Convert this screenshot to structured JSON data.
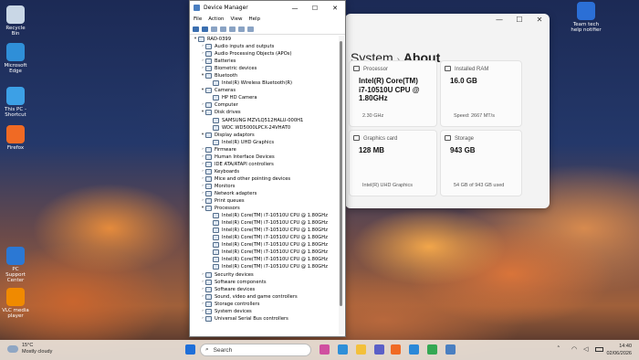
{
  "desktop": {
    "icons": [
      {
        "label": "Recycle Bin",
        "color": "#c9d7e6"
      },
      {
        "label": "Microsoft Edge",
        "color": "#2f8fd8"
      },
      {
        "label": "This PC - Shortcut",
        "color": "#3ca0e6"
      },
      {
        "label": "Firefox",
        "color": "#f06a24"
      },
      {
        "label": "PC Support Center",
        "color": "#2b78d4"
      },
      {
        "label": "VLC media player",
        "color": "#f08a00"
      }
    ],
    "right_icon": {
      "label": "Team tech help notifier",
      "color": "#2b6fd6"
    }
  },
  "device_manager": {
    "title": "Device Manager",
    "controls": [
      "—",
      "☐",
      "✕"
    ],
    "menu": [
      "File",
      "Action",
      "View",
      "Help"
    ],
    "tree": [
      {
        "label": "RAD-0399",
        "level": 0,
        "arrow": "▾"
      },
      {
        "label": "Audio inputs and outputs",
        "level": 1,
        "arrow": "›"
      },
      {
        "label": "Audio Processing Objects (APOs)",
        "level": 1,
        "arrow": "›"
      },
      {
        "label": "Batteries",
        "level": 1,
        "arrow": "›"
      },
      {
        "label": "Biometric devices",
        "level": 1,
        "arrow": "›"
      },
      {
        "label": "Bluetooth",
        "level": 1,
        "arrow": "▾"
      },
      {
        "label": "Intel(R) Wireless Bluetooth(R)",
        "level": 2,
        "arrow": ""
      },
      {
        "label": "Cameras",
        "level": 1,
        "arrow": "▾"
      },
      {
        "label": "HP HD Camera",
        "level": 2,
        "arrow": ""
      },
      {
        "label": "Computer",
        "level": 1,
        "arrow": "›"
      },
      {
        "label": "Disk drives",
        "level": 1,
        "arrow": "▾"
      },
      {
        "label": "SAMSUNG MZVLQ512HALU-000H1",
        "level": 2,
        "arrow": ""
      },
      {
        "label": "WDC WD5000LPCX-24VHAT0",
        "level": 2,
        "arrow": ""
      },
      {
        "label": "Display adaptors",
        "level": 1,
        "arrow": "▾"
      },
      {
        "label": "Intel(R) UHD Graphics",
        "level": 2,
        "arrow": ""
      },
      {
        "label": "Firmware",
        "level": 1,
        "arrow": "›"
      },
      {
        "label": "Human Interface Devices",
        "level": 1,
        "arrow": "›"
      },
      {
        "label": "IDE ATA/ATAPI controllers",
        "level": 1,
        "arrow": "›"
      },
      {
        "label": "Keyboards",
        "level": 1,
        "arrow": "›"
      },
      {
        "label": "Mice and other pointing devices",
        "level": 1,
        "arrow": "›"
      },
      {
        "label": "Monitors",
        "level": 1,
        "arrow": "›"
      },
      {
        "label": "Network adapters",
        "level": 1,
        "arrow": "›"
      },
      {
        "label": "Print queues",
        "level": 1,
        "arrow": "›"
      },
      {
        "label": "Processors",
        "level": 1,
        "arrow": "▾"
      },
      {
        "label": "Intel(R) Core(TM) i7-10510U CPU @ 1.80GHz",
        "level": 2,
        "arrow": ""
      },
      {
        "label": "Intel(R) Core(TM) i7-10510U CPU @ 1.80GHz",
        "level": 2,
        "arrow": ""
      },
      {
        "label": "Intel(R) Core(TM) i7-10510U CPU @ 1.80GHz",
        "level": 2,
        "arrow": ""
      },
      {
        "label": "Intel(R) Core(TM) i7-10510U CPU @ 1.80GHz",
        "level": 2,
        "arrow": ""
      },
      {
        "label": "Intel(R) Core(TM) i7-10510U CPU @ 1.80GHz",
        "level": 2,
        "arrow": ""
      },
      {
        "label": "Intel(R) Core(TM) i7-10510U CPU @ 1.80GHz",
        "level": 2,
        "arrow": ""
      },
      {
        "label": "Intel(R) Core(TM) i7-10510U CPU @ 1.80GHz",
        "level": 2,
        "arrow": ""
      },
      {
        "label": "Intel(R) Core(TM) i7-10510U CPU @ 1.80GHz",
        "level": 2,
        "arrow": ""
      },
      {
        "label": "Security devices",
        "level": 1,
        "arrow": "›"
      },
      {
        "label": "Software components",
        "level": 1,
        "arrow": "›"
      },
      {
        "label": "Software devices",
        "level": 1,
        "arrow": "›"
      },
      {
        "label": "Sound, video and game controllers",
        "level": 1,
        "arrow": "›"
      },
      {
        "label": "Storage controllers",
        "level": 1,
        "arrow": "›"
      },
      {
        "label": "System devices",
        "level": 1,
        "arrow": "›"
      },
      {
        "label": "Universal Serial Bus controllers",
        "level": 1,
        "arrow": "›"
      }
    ]
  },
  "settings": {
    "breadcrumb": {
      "parent": "System",
      "sep": "›",
      "current": "About"
    },
    "controls": [
      "—",
      "☐",
      "✕"
    ],
    "cards": {
      "processor": {
        "label": "Processor",
        "value": "Intel(R) Core(TM) i7-10510U CPU @ 1.80GHz",
        "sub": "2.30 GHz"
      },
      "ram": {
        "label": "Installed RAM",
        "value": "16.0 GB",
        "sub": "Speed: 2667 MT/s"
      },
      "graphics": {
        "label": "Graphics card",
        "value": "128 MB",
        "sub": "Intel(R) UHD Graphics"
      },
      "storage": {
        "label": "Storage",
        "value": "943 GB",
        "sub": "54 GB of 943 GB used"
      }
    }
  },
  "taskbar": {
    "weather": {
      "temp": "15°C",
      "desc": "Mostly cloudy"
    },
    "search_placeholder": "Search",
    "apps": [
      {
        "name": "start",
        "color": "#1e6fd9"
      },
      {
        "name": "copilot",
        "color": "#d04fa0"
      },
      {
        "name": "edge",
        "color": "#2f8fd8"
      },
      {
        "name": "explorer",
        "color": "#f3c03b"
      },
      {
        "name": "teams",
        "color": "#5b5fc7"
      },
      {
        "name": "firefox",
        "color": "#f06a24"
      },
      {
        "name": "store",
        "color": "#2b88d8"
      },
      {
        "name": "chrome",
        "color": "#34a853"
      },
      {
        "name": "devmgr",
        "color": "#4a7fc1"
      }
    ],
    "time": "14:40",
    "date": "02/06/2026"
  }
}
